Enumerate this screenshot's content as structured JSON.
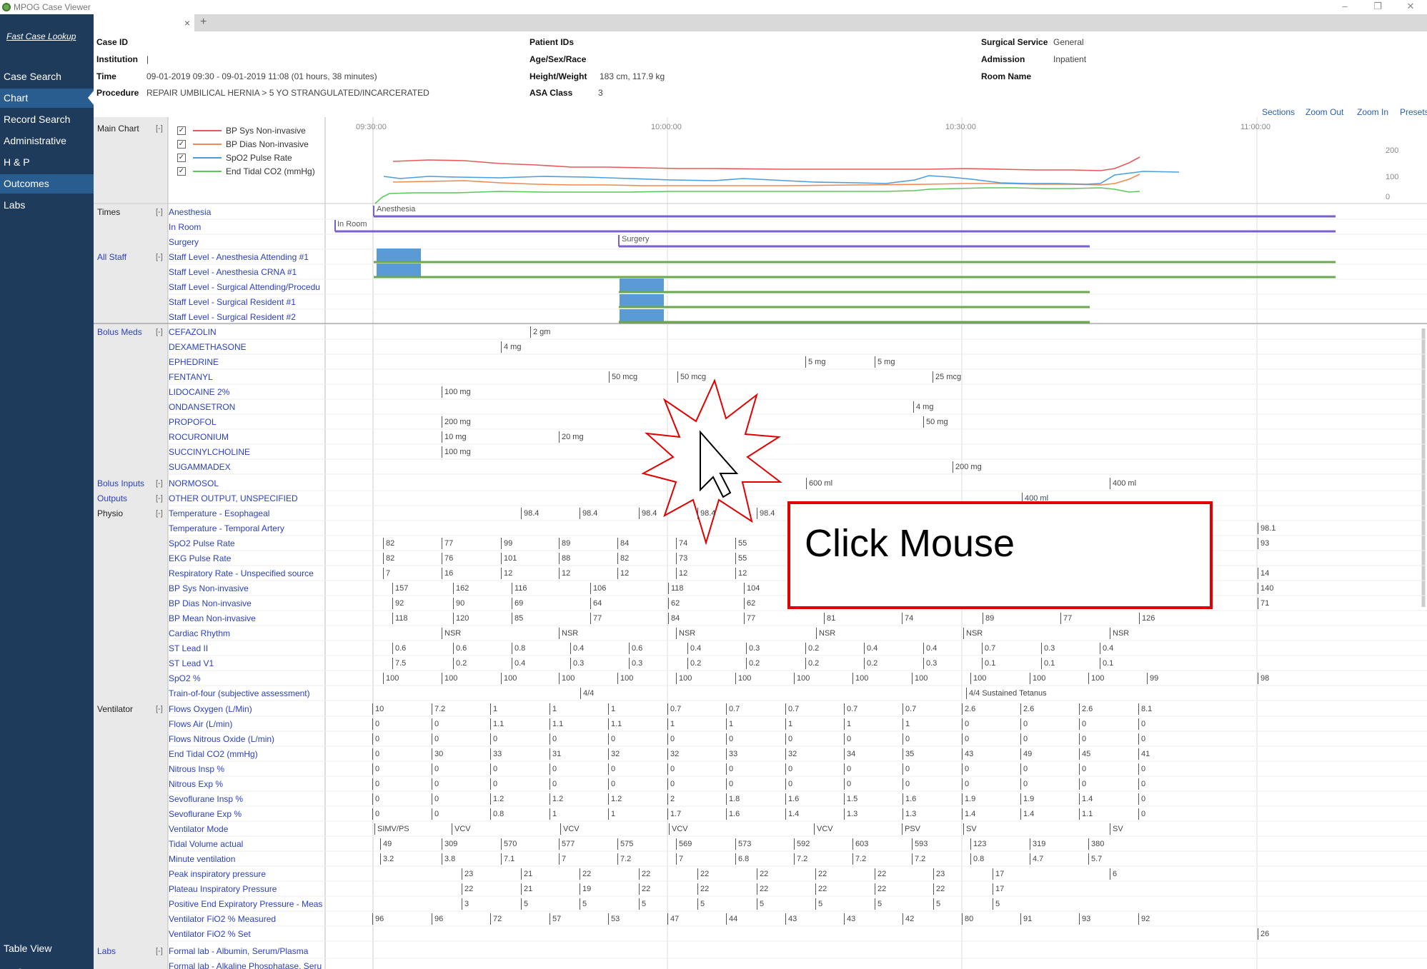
{
  "window": {
    "title": "MPOG Case Viewer",
    "controls": [
      "–",
      "❐",
      "✕"
    ]
  },
  "tab": {
    "label": "",
    "close": "×",
    "add": "+"
  },
  "sidebar": {
    "fast_lookup": "Fast Case Lookup",
    "items": [
      "Case Search",
      "Chart",
      "Record Search",
      "Administrative",
      "H & P",
      "Outcomes",
      "Labs"
    ],
    "bottom": [
      "Table View",
      "Preferences"
    ]
  },
  "case": {
    "case_id_label": "Case ID",
    "institution_label": "Institution",
    "institution_value": "|",
    "time_label": "Time",
    "time_value": "09-01-2019 09:30 - 09-01-2019 11:08 (01 hours, 38 minutes)",
    "procedure_label": "Procedure",
    "procedure_value": "REPAIR UMBILICAL HERNIA > 5 YO STRANGULATED/INCARCERATED",
    "patient_ids_label": "Patient IDs",
    "age_label": "Age/Sex/Race",
    "height_label": "Height/Weight",
    "height_value": "183 cm, 117.9 kg",
    "asa_label": "ASA Class",
    "asa_value": "3",
    "service_label": "Surgical Service",
    "service_value": "General",
    "admission_label": "Admission",
    "admission_value": "Inpatient",
    "room_label": "Room Name"
  },
  "toolbar": {
    "sections": "Sections",
    "zoom_out": "Zoom Out",
    "zoom_in": "Zoom In",
    "presets": "Presets"
  },
  "main_chart": {
    "label": "Main Chart",
    "collapse": "[-]",
    "times": [
      "09:30:00",
      "10:00:00",
      "10:30:00",
      "11:00:00"
    ],
    "yticks": [
      "200",
      "100",
      "0"
    ],
    "legend": [
      {
        "label": "BP Sys Non-invasive",
        "color": "#e8585a"
      },
      {
        "label": "BP Dias Non-invasive",
        "color": "#f08a50"
      },
      {
        "label": "SpO2 Pulse Rate",
        "color": "#4a9ee0"
      },
      {
        "label": "End Tidal CO2 (mmHg)",
        "color": "#5cc85c"
      }
    ]
  },
  "groups": {
    "times": "Times",
    "all_staff": "All Staff",
    "bolus_meds": "Bolus Meds",
    "bolus_inputs": "Bolus Inputs",
    "outputs": "Outputs",
    "physio": "Physio",
    "ventilator": "Ventilator",
    "labs": "Labs"
  },
  "rows": {
    "times": [
      "Anesthesia",
      "In Room",
      "Surgery"
    ],
    "staff": [
      "Staff Level - Anesthesia Attending #1",
      "Staff Level - Anesthesia CRNA #1",
      "Staff Level - Surgical Attending/Procedu",
      "Staff Level - Surgical Resident #1",
      "Staff Level - Surgical Resident #2"
    ],
    "meds": [
      "CEFAZOLIN",
      "DEXAMETHASONE",
      "EPHEDRINE",
      "FENTANYL",
      "LIDOCAINE 2%",
      "ONDANSETRON",
      "PROPOFOL",
      "ROCURONIUM",
      "SUCCINYLCHOLINE",
      "SUGAMMADEX"
    ],
    "inputs": [
      "NORMOSOL"
    ],
    "outputs": [
      "OTHER OUTPUT, UNSPECIFIED"
    ],
    "physio": [
      "Temperature - Esophageal",
      "Temperature - Temporal Artery",
      "SpO2 Pulse Rate",
      "EKG Pulse Rate",
      "Respiratory Rate - Unspecified source",
      "BP Sys Non-invasive",
      "BP Dias Non-invasive",
      "BP Mean Non-invasive",
      "Cardiac Rhythm",
      "ST Lead II",
      "ST Lead V1",
      "SpO2 %",
      "Train-of-four (subjective assessment)"
    ],
    "vent": [
      "Flows Oxygen (L/Min)",
      "Flows Air (L/min)",
      "Flows Nitrous Oxide (L/min)",
      "End Tidal CO2 (mmHg)",
      "Nitrous Insp %",
      "Nitrous Exp %",
      "Sevoflurane Insp %",
      "Sevoflurane Exp %",
      "Ventilator Mode",
      "Tidal Volume actual",
      "Minute ventilation",
      "Peak inspiratory pressure",
      "Plateau Inspiratory Pressure",
      "Positive End Expiratory Pressure - Meas",
      "Ventilator FiO2 % Measured",
      "Ventilator FiO2 % Set"
    ],
    "labs": [
      "Formal lab - Albumin, Serum/Plasma",
      "Formal lab - Alkaline Phosphatase, Seru"
    ]
  },
  "bar_labels": {
    "anesthesia": "Anesthesia",
    "in_room": "In Room",
    "surgery": "Surgery"
  },
  "cells": {
    "meds": [
      [
        [
          "2 gm",
          742
        ]
      ],
      [
        [
          "4 mg",
          701
        ]
      ],
      [
        [
          "5 mg",
          1127
        ],
        [
          "5 mg",
          1224
        ]
      ],
      [
        [
          "50 mcg",
          852
        ],
        [
          "50 mcg",
          948
        ],
        [
          "25 mcg",
          1305
        ]
      ],
      [
        [
          "100 mg",
          618
        ]
      ],
      [
        [
          "4 mg",
          1278
        ]
      ],
      [
        [
          "200 mg",
          618
        ],
        [
          "50 mg",
          1292
        ]
      ],
      [
        [
          "10 mg",
          618
        ],
        [
          "20 mg",
          782
        ]
      ],
      [
        [
          "100 mg",
          618
        ]
      ],
      [
        [
          "200 mg",
          1333
        ]
      ]
    ],
    "inputs": [
      [
        "600 ml",
        1128
      ],
      [
        "400 ml",
        1553
      ]
    ],
    "outputs": [
      [
        "400 ml",
        1430
      ]
    ],
    "temp_eso": [
      [
        "98.4",
        729
      ],
      [
        "98.4",
        811
      ],
      [
        "98.4",
        894
      ],
      [
        "98.4",
        976
      ],
      [
        "98.4",
        1059
      ]
    ],
    "temp_art": [
      [
        "98.1",
        1760
      ]
    ],
    "spo2_pulse": [
      [
        "82",
        536
      ],
      [
        "77",
        618
      ],
      [
        "99",
        701
      ],
      [
        "89",
        782
      ],
      [
        "84",
        864
      ],
      [
        "74",
        946
      ],
      [
        "55",
        1029
      ],
      [
        "93",
        1760
      ]
    ],
    "ekg": [
      [
        "82",
        536
      ],
      [
        "76",
        618
      ],
      [
        "101",
        701
      ],
      [
        "88",
        782
      ],
      [
        "82",
        864
      ],
      [
        "73",
        946
      ],
      [
        "55",
        1029
      ]
    ],
    "resp": [
      [
        "7",
        536
      ],
      [
        "16",
        618
      ],
      [
        "12",
        701
      ],
      [
        "12",
        782
      ],
      [
        "12",
        864
      ],
      [
        "12",
        946
      ],
      [
        "12",
        1029
      ],
      [
        "14",
        1760
      ]
    ],
    "bp_sys": [
      [
        "157",
        549
      ],
      [
        "162",
        634
      ],
      [
        "116",
        716
      ],
      [
        "106",
        826
      ],
      [
        "118",
        935
      ],
      [
        "104",
        1041
      ],
      [
        "140",
        1760
      ]
    ],
    "bp_dias": [
      [
        "92",
        549
      ],
      [
        "90",
        634
      ],
      [
        "69",
        716
      ],
      [
        "64",
        826
      ],
      [
        "62",
        935
      ],
      [
        "62",
        1041
      ],
      [
        "71",
        1760
      ]
    ],
    "bp_mean": [
      [
        "118",
        549
      ],
      [
        "120",
        634
      ],
      [
        "85",
        716
      ],
      [
        "77",
        826
      ],
      [
        "84",
        935
      ],
      [
        "77",
        1041
      ],
      [
        "81",
        1153
      ],
      [
        "74",
        1262
      ],
      [
        "89",
        1375
      ],
      [
        "77",
        1484
      ],
      [
        "126",
        1594
      ]
    ],
    "rhythm": [
      [
        "NSR",
        618
      ],
      [
        "NSR",
        782
      ],
      [
        "NSR",
        946
      ],
      [
        "NSR",
        1142
      ],
      [
        "NSR",
        1348
      ],
      [
        "NSR",
        1553
      ]
    ],
    "st2": [
      [
        "0.6",
        549
      ],
      [
        "0.6",
        634
      ],
      [
        "0.8",
        716
      ],
      [
        "0.4",
        798
      ],
      [
        "0.6",
        880
      ],
      [
        "0.4",
        962
      ],
      [
        "0.3",
        1044
      ],
      [
        "0.2",
        1127
      ],
      [
        "0.4",
        1209
      ],
      [
        "0.4",
        1292
      ],
      [
        "0.7",
        1374
      ],
      [
        "0.3",
        1457
      ],
      [
        "0.4",
        1539
      ]
    ],
    "stv1": [
      [
        "7.5",
        549
      ],
      [
        "0.2",
        634
      ],
      [
        "0.4",
        716
      ],
      [
        "0.3",
        798
      ],
      [
        "0.3",
        880
      ],
      [
        "0.2",
        962
      ],
      [
        "0.2",
        1044
      ],
      [
        "0.2",
        1127
      ],
      [
        "0.2",
        1209
      ],
      [
        "0.3",
        1292
      ],
      [
        "0.1",
        1374
      ],
      [
        "0.1",
        1457
      ],
      [
        "0.1",
        1539
      ]
    ],
    "spo2": [
      [
        "100",
        536
      ],
      [
        "100",
        618
      ],
      [
        "100",
        701
      ],
      [
        "100",
        782
      ],
      [
        "100",
        864
      ],
      [
        "100",
        946
      ],
      [
        "100",
        1029
      ],
      [
        "100",
        1111
      ],
      [
        "100",
        1193
      ],
      [
        "100",
        1276
      ],
      [
        "100",
        1358
      ],
      [
        "100",
        1441
      ],
      [
        "100",
        1523
      ],
      [
        "99",
        1605
      ],
      [
        "98",
        1760
      ]
    ],
    "tof": [
      [
        "4/4",
        812
      ],
      [
        "4/4 Sustained Tetanus",
        1352
      ]
    ],
    "vent_cols": [
      521,
      604,
      686,
      769,
      851,
      934,
      1016,
      1099,
      1181,
      1263,
      1346,
      1428,
      1510,
      1593
    ],
    "vent_rows": [
      [
        "10",
        "7.2",
        "1",
        "1",
        "1",
        "0.7",
        "0.7",
        "0.7",
        "0.7",
        "0.7",
        "2.6",
        "2.6",
        "2.6",
        "8.1"
      ],
      [
        "0",
        "0",
        "1.1",
        "1.1",
        "1.1",
        "1",
        "1",
        "1",
        "1",
        "1",
        "0",
        "0",
        "0",
        "0"
      ],
      [
        "0",
        "0",
        "0",
        "0",
        "0",
        "0",
        "0",
        "0",
        "0",
        "0",
        "0",
        "0",
        "0",
        "0"
      ],
      [
        "0",
        "30",
        "33",
        "31",
        "32",
        "32",
        "33",
        "32",
        "34",
        "35",
        "43",
        "49",
        "45",
        "41"
      ],
      [
        "0",
        "0",
        "0",
        "0",
        "0",
        "0",
        "0",
        "0",
        "0",
        "0",
        "0",
        "0",
        "0",
        "0"
      ],
      [
        "0",
        "0",
        "0",
        "0",
        "0",
        "0",
        "0",
        "0",
        "0",
        "0",
        "0",
        "0",
        "0",
        "0"
      ],
      [
        "0",
        "0",
        "1.2",
        "1.2",
        "1.2",
        "2",
        "1.8",
        "1.6",
        "1.5",
        "1.6",
        "1.9",
        "1.9",
        "1.4",
        "0"
      ],
      [
        "0",
        "0",
        "0.8",
        "1",
        "1",
        "1.7",
        "1.6",
        "1.4",
        "1.3",
        "1.3",
        "1.4",
        "1.4",
        "1.1",
        "0"
      ]
    ],
    "vent_mode": [
      [
        "SIMV/PS",
        524
      ],
      [
        "VCV",
        632
      ],
      [
        "VCV",
        784
      ],
      [
        "VCV",
        936
      ],
      [
        "VCV",
        1139
      ],
      [
        "PSV",
        1262
      ],
      [
        "SV",
        1348
      ],
      [
        "SV",
        1553
      ]
    ],
    "tidal": [
      [
        "49",
        532
      ],
      [
        "309",
        618
      ],
      [
        "570",
        701
      ],
      [
        "577",
        782
      ],
      [
        "575",
        864
      ],
      [
        "569",
        946
      ],
      [
        "573",
        1029
      ],
      [
        "592",
        1111
      ],
      [
        "603",
        1193
      ],
      [
        "593",
        1276
      ],
      [
        "123",
        1358
      ],
      [
        "319",
        1441
      ],
      [
        "380",
        1523
      ]
    ],
    "minute": [
      [
        "3.2",
        532
      ],
      [
        "3.8",
        618
      ],
      [
        "7.1",
        701
      ],
      [
        "7",
        782
      ],
      [
        "7.2",
        864
      ],
      [
        "7",
        946
      ],
      [
        "6.8",
        1029
      ],
      [
        "7.2",
        1111
      ],
      [
        "7.2",
        1193
      ],
      [
        "7.2",
        1276
      ],
      [
        "0.8",
        1358
      ],
      [
        "4.7",
        1441
      ],
      [
        "5.7",
        1523
      ]
    ],
    "peak": [
      [
        "23",
        646
      ],
      [
        "21",
        729
      ],
      [
        "22",
        811
      ],
      [
        "22",
        894
      ],
      [
        "22",
        976
      ],
      [
        "22",
        1059
      ],
      [
        "22",
        1141
      ],
      [
        "22",
        1224
      ],
      [
        "23",
        1306
      ],
      [
        "17",
        1389
      ],
      [
        "6",
        1553
      ]
    ],
    "plateau": [
      [
        "22",
        646
      ],
      [
        "21",
        729
      ],
      [
        "19",
        811
      ],
      [
        "22",
        894
      ],
      [
        "22",
        976
      ],
      [
        "22",
        1059
      ],
      [
        "22",
        1141
      ],
      [
        "22",
        1224
      ],
      [
        "22",
        1306
      ],
      [
        "17",
        1389
      ]
    ],
    "peep": [
      [
        "3",
        646
      ],
      [
        "5",
        729
      ],
      [
        "5",
        811
      ],
      [
        "5",
        894
      ],
      [
        "5",
        976
      ],
      [
        "5",
        1059
      ],
      [
        "5",
        1141
      ],
      [
        "5",
        1224
      ],
      [
        "5",
        1306
      ],
      [
        "5",
        1389
      ]
    ],
    "fio2_meas": [
      [
        "96",
        521
      ],
      [
        "96",
        604
      ],
      [
        "72",
        686
      ],
      [
        "57",
        769
      ],
      [
        "53",
        851
      ],
      [
        "47",
        934
      ],
      [
        "44",
        1016
      ],
      [
        "43",
        1099
      ],
      [
        "43",
        1181
      ],
      [
        "42",
        1263
      ],
      [
        "80",
        1346
      ],
      [
        "91",
        1428
      ],
      [
        "93",
        1510
      ],
      [
        "92",
        1593
      ]
    ],
    "fio2_set": [
      [
        "26",
        1760
      ]
    ]
  },
  "callout": {
    "text": "Click Mouse"
  }
}
